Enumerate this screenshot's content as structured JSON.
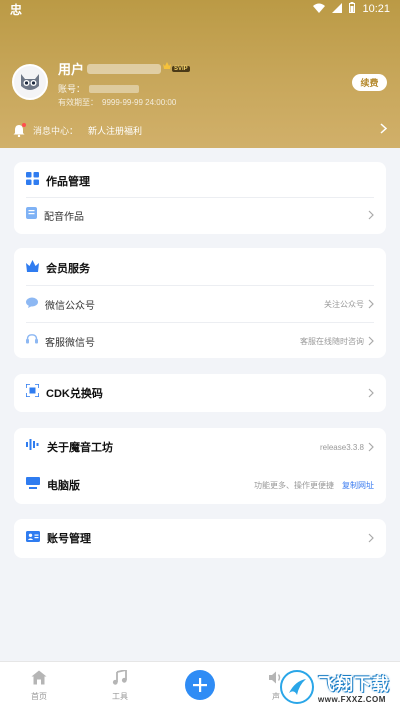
{
  "status_bar": {
    "app_glyph": "忠",
    "time": "10:21"
  },
  "profile": {
    "name_prefix": "用户",
    "vip_tag": "SVIP",
    "account_label": "账号：",
    "expiry_label": "有效期至：",
    "expiry_value": "9999-99-99 24:00:00",
    "renew_label": "续费"
  },
  "message_center": {
    "label": "消息中心：",
    "text": "新人注册福利"
  },
  "works_card": {
    "title": "作品管理",
    "items": [
      {
        "label": "配音作品"
      }
    ]
  },
  "member_card": {
    "title": "会员服务",
    "items": [
      {
        "label": "微信公众号",
        "hint": "关注公众号"
      },
      {
        "label": "客服微信号",
        "hint": "客服在线随时咨询"
      }
    ]
  },
  "cdk_card": {
    "title": "CDK兑换码"
  },
  "about_card": {
    "items": [
      {
        "label": "关于魔音工坊",
        "hint": "release3.3.8"
      },
      {
        "label": "电脑版",
        "hint": "功能更多、操作更便捷",
        "link": "复制网址"
      }
    ]
  },
  "account_card": {
    "title": "账号管理"
  },
  "bottom_nav": {
    "items": [
      {
        "label": "首页",
        "icon": "home-icon"
      },
      {
        "label": "工具",
        "icon": "music-note-icon"
      },
      {
        "label": "声",
        "icon": "sound-icon"
      }
    ],
    "center_icon": "plus-icon"
  },
  "watermark": {
    "main": "飞翔下载",
    "sub": "www.FXXZ.COM"
  },
  "colors": {
    "accent_gold": "#c8a75b",
    "primary_blue": "#2f8cf5",
    "link_blue": "#3a7bf0"
  }
}
